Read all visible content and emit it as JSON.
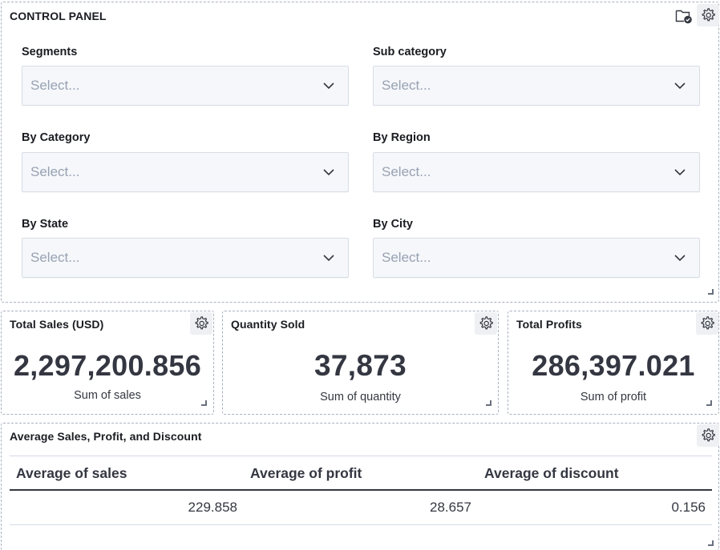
{
  "control_panel": {
    "title": "CONTROL PANEL",
    "filters": [
      {
        "label": "Segments",
        "placeholder": "Select..."
      },
      {
        "label": "Sub category",
        "placeholder": "Select..."
      },
      {
        "label": "By Category",
        "placeholder": "Select..."
      },
      {
        "label": "By Region",
        "placeholder": "Select..."
      },
      {
        "label": "By State",
        "placeholder": "Select..."
      },
      {
        "label": "By City",
        "placeholder": "Select..."
      }
    ]
  },
  "metrics": [
    {
      "title": "Total Sales (USD)",
      "value": "2,297,200.856",
      "subtitle": "Sum of sales"
    },
    {
      "title": "Quantity Sold",
      "value": "37,873",
      "subtitle": "Sum of quantity"
    },
    {
      "title": "Total Profits",
      "value": "286,397.021",
      "subtitle": "Sum of profit"
    }
  ],
  "averages_table": {
    "title": "Average Sales, Profit, and Discount",
    "columns": [
      "Average of sales",
      "Average of profit",
      "Average of discount"
    ],
    "rows": [
      [
        "229.858",
        "28.657",
        "0.156"
      ]
    ]
  },
  "icons": {
    "settings": "gear-icon",
    "folder_check": "folder-check-icon",
    "dropdown": "chevron-down-icon",
    "resize": "resize-handle-icon"
  },
  "colors": {
    "text": "#343741",
    "heading": "#1a1c21",
    "placeholder": "#98a2b3",
    "select_bg": "#f5f7fa",
    "panel_border": "#a9b1bf"
  }
}
